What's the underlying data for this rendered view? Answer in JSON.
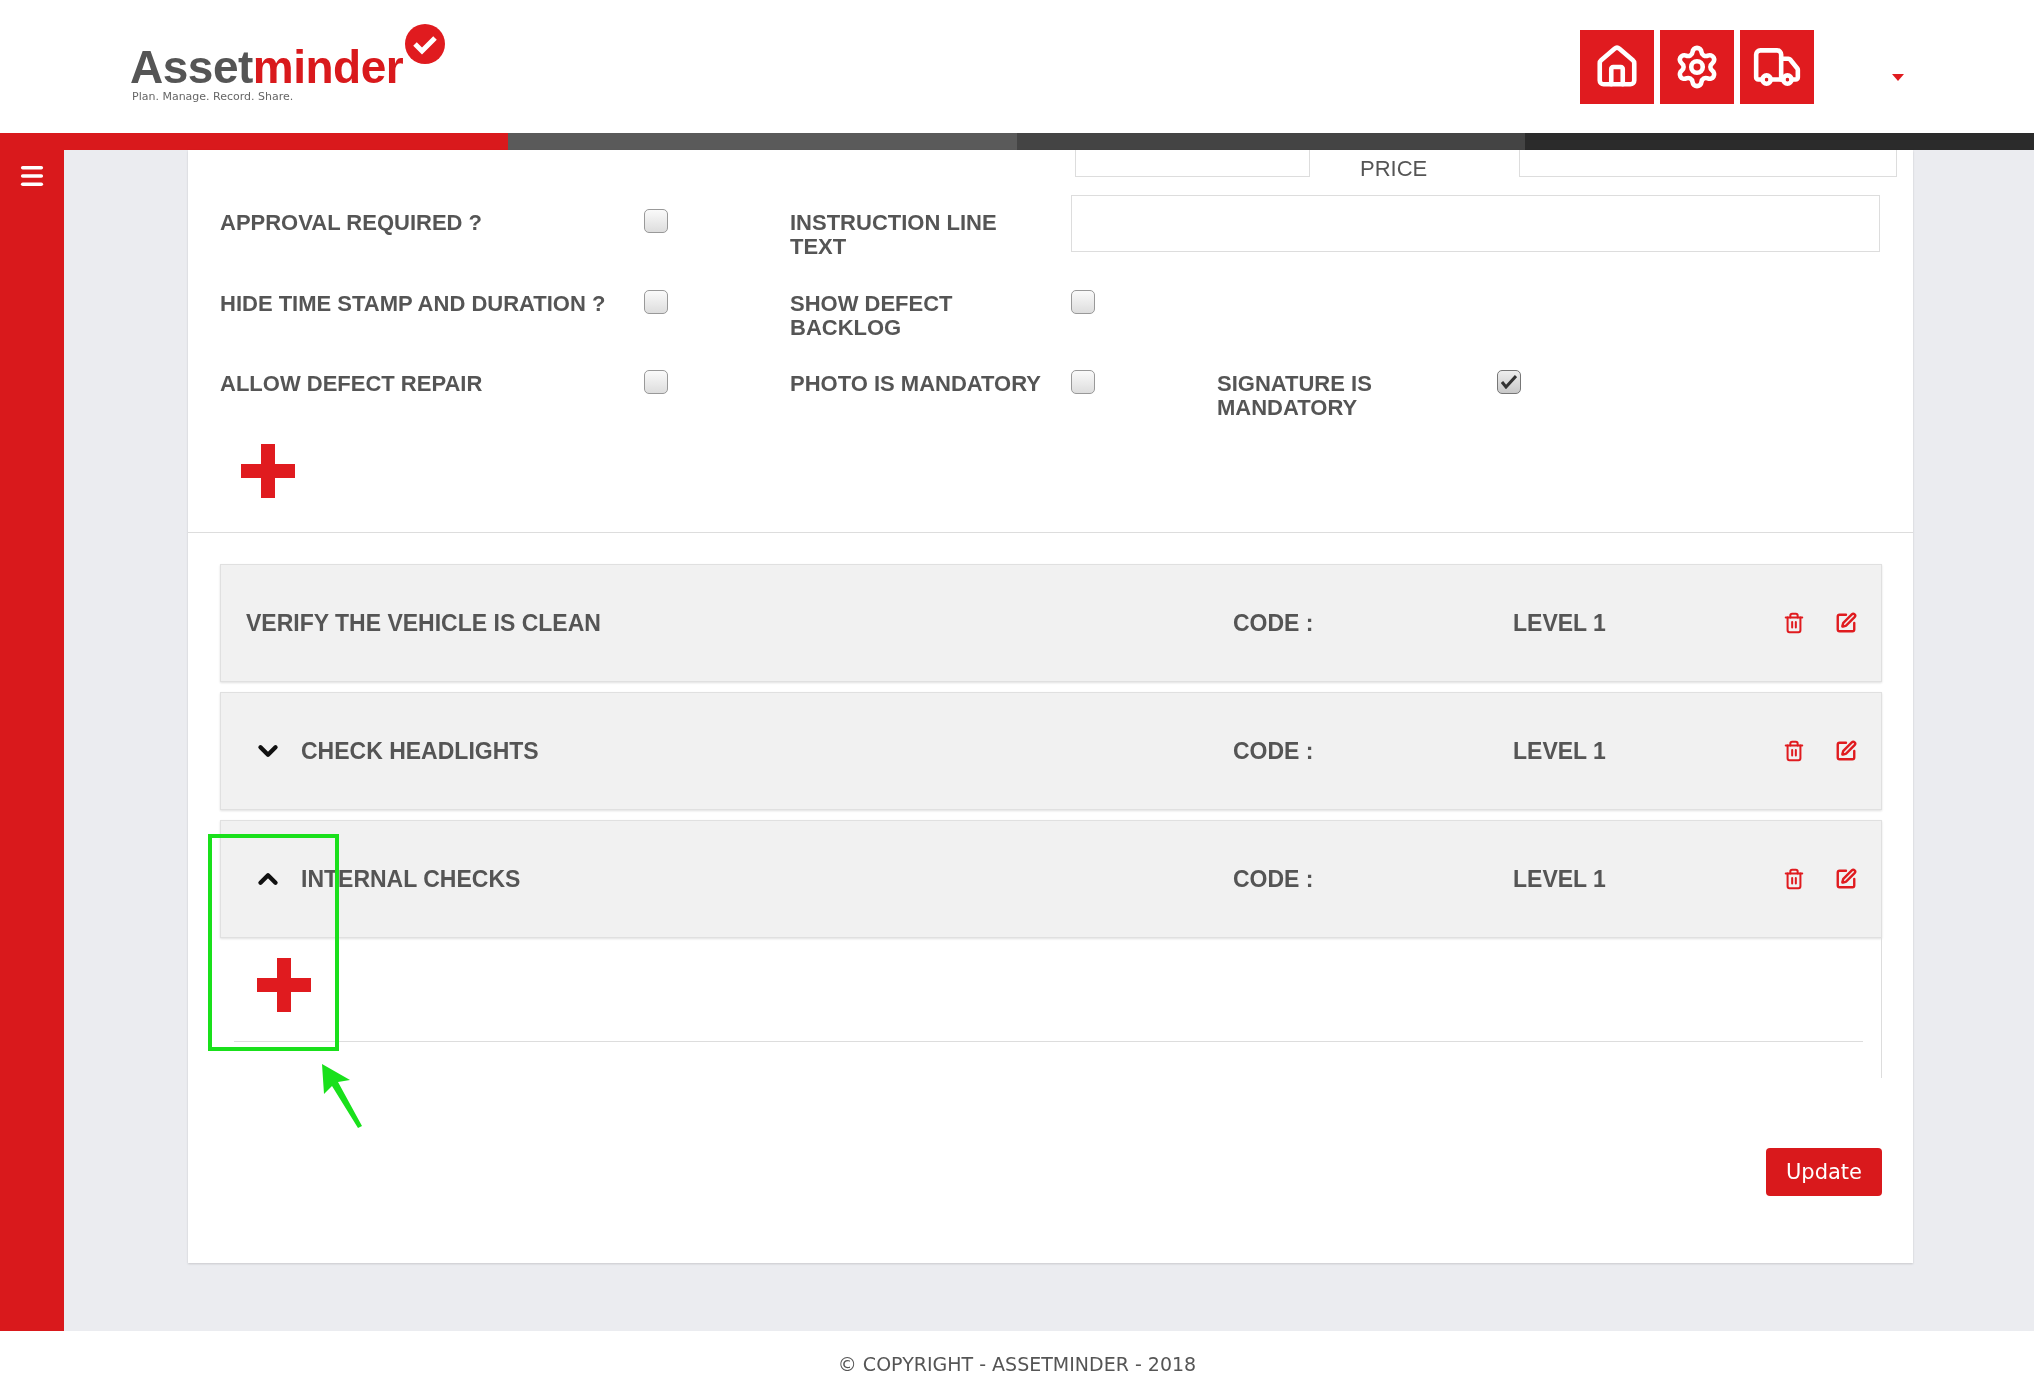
{
  "header": {
    "logo": {
      "name_dark": "Asset",
      "name_red": "minder",
      "tagline": "Plan. Manage. Record. Share."
    }
  },
  "form": {
    "price_label": "PRICE",
    "rows": [
      {
        "cells": [
          {
            "kind": "checkbox",
            "label": "APPROVAL REQUIRED ?",
            "checked": false
          },
          {
            "kind": "text",
            "label": "INSTRUCTION LINE TEXT"
          }
        ]
      },
      {
        "cells": [
          {
            "kind": "checkbox",
            "label": "HIDE TIME STAMP AND DURATION ?",
            "checked": false
          },
          {
            "kind": "checkbox",
            "label": "SHOW DEFECT BACKLOG",
            "checked": false
          }
        ]
      },
      {
        "cells": [
          {
            "kind": "checkbox",
            "label": "ALLOW DEFECT REPAIR",
            "checked": false
          },
          {
            "kind": "checkbox",
            "label": "PHOTO IS MANDATORY",
            "checked": false
          },
          {
            "kind": "checkbox",
            "label": "SIGNATURE IS MANDATORY",
            "checked": true
          }
        ]
      }
    ]
  },
  "checks": [
    {
      "kind": "plain",
      "title": "VERIFY THE VEHICLE IS CLEAN",
      "code": "CODE :",
      "level": "LEVEL 1"
    },
    {
      "kind": "group",
      "title": "CHECK HEADLIGHTS",
      "code": "CODE :",
      "level": "LEVEL 1",
      "expanded": false
    },
    {
      "kind": "group",
      "title": "INTERNAL CHECKS",
      "code": "CODE :",
      "level": "LEVEL 1",
      "expanded": true
    }
  ],
  "update_button": "Update",
  "footer": "© COPYRIGHT - ASSETMINDER - 2018"
}
